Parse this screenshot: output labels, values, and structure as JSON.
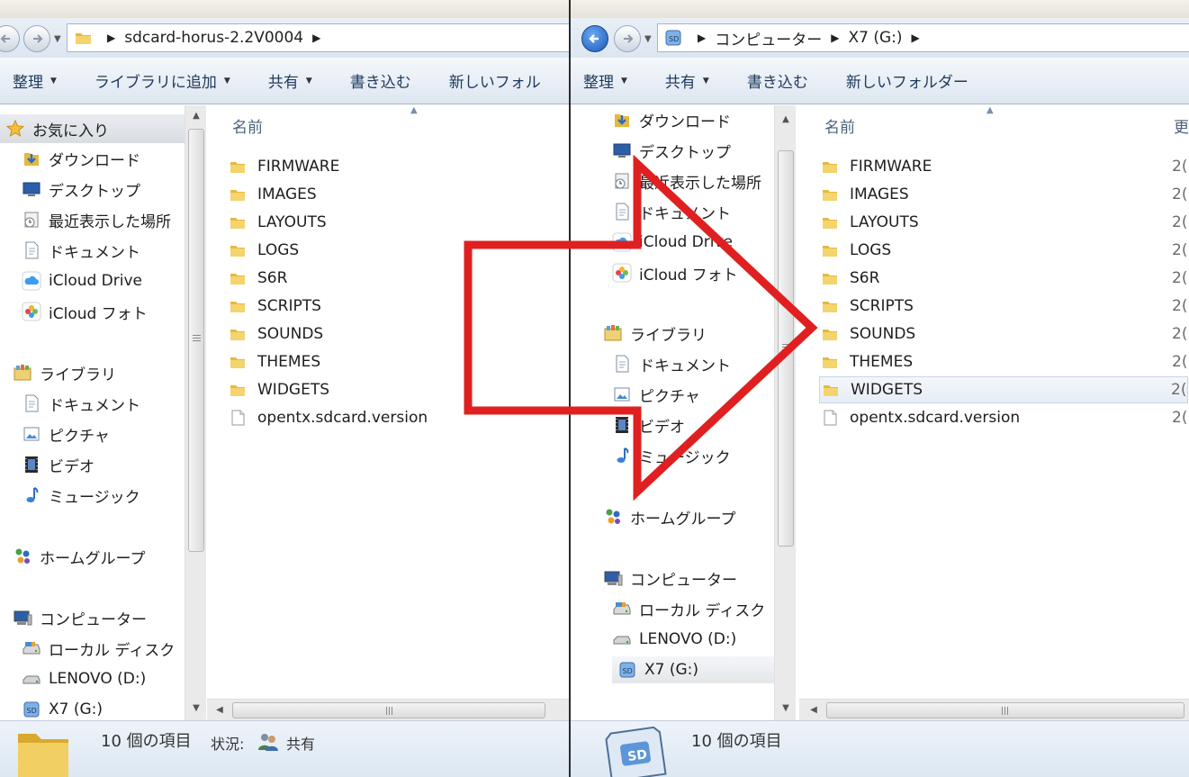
{
  "left_window": {
    "address": {
      "crumbs": [
        "sdcard-horus-2.2V0004"
      ]
    },
    "toolbar": [
      {
        "label": "整理",
        "dropdown": true
      },
      {
        "label": "ライブラリに追加",
        "dropdown": true
      },
      {
        "label": "共有",
        "dropdown": true
      },
      {
        "label": "書き込む",
        "dropdown": false
      },
      {
        "label": "新しいフォル",
        "dropdown": false
      }
    ],
    "nav": {
      "favorites": "お気に入り",
      "favorites_items": [
        "ダウンロード",
        "デスクトップ",
        "最近表示した場所",
        "ドキュメント",
        "iCloud Drive",
        "iCloud フォト"
      ],
      "libraries": "ライブラリ",
      "libraries_items": [
        "ドキュメント",
        "ピクチャ",
        "ビデオ",
        "ミュージック"
      ],
      "homegroup": "ホームグループ",
      "computer": "コンピューター",
      "computer_items": [
        "ローカル ディスク",
        "LENOVO (D:)",
        "X7 (G:)"
      ]
    },
    "column_name": "名前",
    "files": [
      "FIRMWARE",
      "IMAGES",
      "LAYOUTS",
      "LOGS",
      "S6R",
      "SCRIPTS",
      "SOUNDS",
      "THEMES",
      "WIDGETS",
      "opentx.sdcard.version"
    ],
    "status": {
      "count": "10 個の項目",
      "state_label": "状況:",
      "state_value": "共有"
    }
  },
  "right_window": {
    "address": {
      "crumbs": [
        "コンピューター",
        "X7 (G:)"
      ]
    },
    "toolbar": [
      {
        "label": "整理",
        "dropdown": true
      },
      {
        "label": "共有",
        "dropdown": true
      },
      {
        "label": "書き込む",
        "dropdown": false
      },
      {
        "label": "新しいフォルダー",
        "dropdown": false
      }
    ],
    "nav": {
      "favorites_items": [
        "ダウンロード",
        "デスクトップ",
        "最近表示した場所",
        "ドキュメント",
        "iCloud Drive",
        "iCloud フォト"
      ],
      "libraries": "ライブラリ",
      "libraries_items": [
        "ドキュメント",
        "ピクチャ",
        "ビデオ",
        "ミュージック"
      ],
      "homegroup": "ホームグループ",
      "computer": "コンピューター",
      "computer_items": [
        "ローカル ディスク",
        "LENOVO (D:)",
        "X7 (G:)"
      ]
    },
    "column_name": "名前",
    "column_date": "更",
    "date_prefix": "2(",
    "files": [
      "FIRMWARE",
      "IMAGES",
      "LAYOUTS",
      "LOGS",
      "S6R",
      "SCRIPTS",
      "SOUNDS",
      "THEMES",
      "WIDGETS",
      "opentx.sdcard.version"
    ],
    "status": {
      "count": "10 個の項目"
    }
  },
  "colors": {
    "overlay_arrow": "#e02020",
    "folder": "#e8c04a",
    "accent": "#1c59b8"
  }
}
